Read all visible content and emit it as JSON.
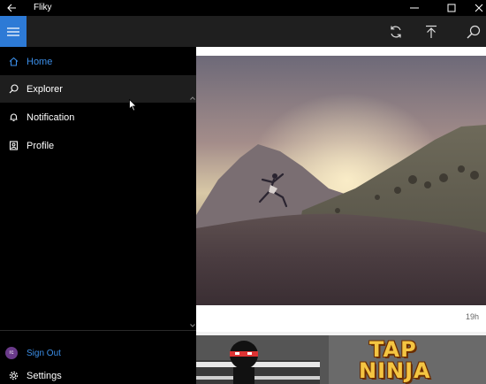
{
  "window": {
    "title": "Fliky"
  },
  "sidebar": {
    "items": [
      {
        "label": "Home",
        "icon": "home-icon",
        "active": true
      },
      {
        "label": "Explorer",
        "icon": "search-icon",
        "hover": true
      },
      {
        "label": "Notification",
        "icon": "bell-icon"
      },
      {
        "label": "Profile",
        "icon": "profile-icon"
      }
    ],
    "signout_label": "Sign Out",
    "avatar_text": "rc",
    "settings_label": "Settings"
  },
  "feed": {
    "cards": [
      {
        "time": "19h"
      },
      {
        "title_line1": "TAP",
        "title_line2": "NINJA"
      }
    ]
  },
  "colors": {
    "accent": "#2d7ad6",
    "active_text": "#3b8ee8",
    "appbar": "#1f1f1f",
    "sidebar": "#000000"
  }
}
